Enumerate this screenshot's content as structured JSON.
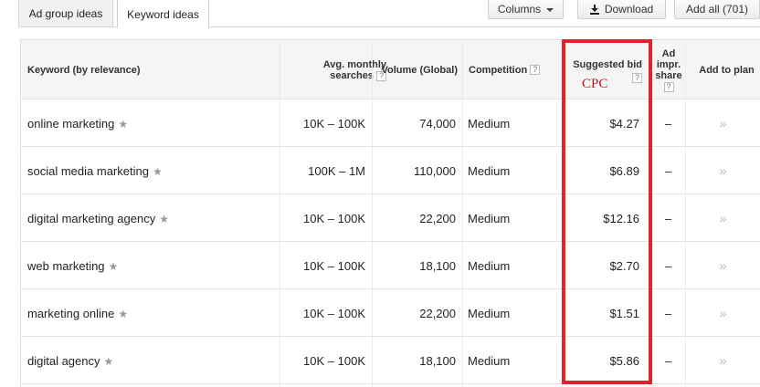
{
  "tabs": [
    {
      "label": "Ad group ideas",
      "active": false
    },
    {
      "label": "Keyword ideas",
      "active": true
    }
  ],
  "toolbar": {
    "columns_label": "Columns",
    "download_label": "Download",
    "add_all_label": "Add all (701)"
  },
  "table": {
    "headers": {
      "keyword": "Keyword (by relevance)",
      "avg_monthly_1": "Avg. monthly",
      "avg_monthly_2": "searches",
      "volume": "Volume (Global)",
      "competition": "Competition",
      "suggested_bid": "Suggested bid",
      "ad_impr_1": "Ad",
      "ad_impr_2": "impr.",
      "ad_impr_3": "share",
      "add_to_plan": "Add to plan",
      "help_glyph": "?"
    },
    "rows": [
      {
        "keyword": "online marketing",
        "avg": "10K – 100K",
        "volume": "74,000",
        "competition": "Medium",
        "bid": "$4.27",
        "share": "–",
        "add": "»"
      },
      {
        "keyword": "social media marketing",
        "avg": "100K – 1M",
        "volume": "110,000",
        "competition": "Medium",
        "bid": "$6.89",
        "share": "–",
        "add": "»"
      },
      {
        "keyword": "digital marketing agency",
        "avg": "10K – 100K",
        "volume": "22,200",
        "competition": "Medium",
        "bid": "$12.16",
        "share": "–",
        "add": "»"
      },
      {
        "keyword": "web marketing",
        "avg": "10K – 100K",
        "volume": "18,100",
        "competition": "Medium",
        "bid": "$2.70",
        "share": "–",
        "add": "»"
      },
      {
        "keyword": "marketing online",
        "avg": "10K – 100K",
        "volume": "22,200",
        "competition": "Medium",
        "bid": "$1.51",
        "share": "–",
        "add": "»"
      },
      {
        "keyword": "digital agency",
        "avg": "10K – 100K",
        "volume": "18,100",
        "competition": "Medium",
        "bid": "$5.86",
        "share": "–",
        "add": "»"
      }
    ]
  },
  "annotation": {
    "label": "CPC",
    "color": "#e0242b"
  }
}
